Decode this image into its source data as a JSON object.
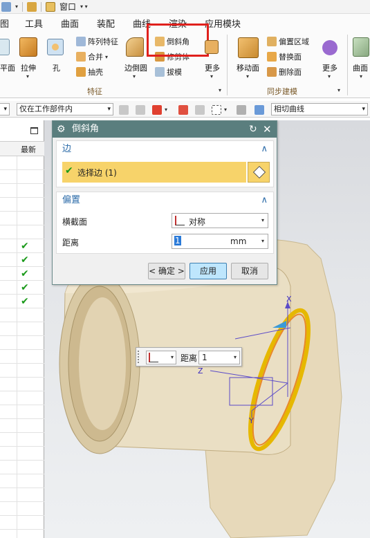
{
  "quick_access": {
    "window_menu": "窗口"
  },
  "menubar": {
    "items": [
      "图",
      "工具",
      "曲面",
      "装配",
      "曲线",
      "渲染",
      "应用模块"
    ]
  },
  "ribbon": {
    "buttons": {
      "plane": "平面",
      "extrude": "拉伸",
      "hole": "孔",
      "edge_blend": "边倒圆",
      "more1": "更多",
      "move_face": "移动面",
      "more2": "更多",
      "surface": "曲面"
    },
    "feature_small": [
      "阵列特征",
      "合并",
      "抽壳"
    ],
    "chamfer_small": [
      "倒斜角",
      "修剪体",
      "拔模"
    ],
    "sync_small": [
      "偏置区域",
      "替换面",
      "删除面"
    ],
    "groups": {
      "feature": "特征",
      "sync": "同步建模"
    }
  },
  "selection_bar": {
    "scope": "仅在工作部件内",
    "curve_rule": "相切曲线"
  },
  "left_panel": {
    "column_header": "最新",
    "check_rows": 5
  },
  "dialog": {
    "title": "倒斜角",
    "section_edge": {
      "title": "边",
      "select_label": "选择边 (1)"
    },
    "section_offset": {
      "title": "偏置",
      "cross_section_label": "横截面",
      "cross_section_value": "对称",
      "distance_label": "距离",
      "distance_value": "1",
      "unit": "mm"
    },
    "buttons": {
      "ok": "< 确定 >",
      "apply": "应用",
      "cancel": "取消"
    }
  },
  "handle": {
    "distance_label": "距离",
    "distance_value": "1"
  },
  "axes": {
    "x": "X",
    "y": "Y",
    "z": "Z"
  },
  "colors": {
    "dialog_title": "#5a7e7e",
    "selected_row": "#f7d36a",
    "highlight_box": "#e0201c",
    "part": "#e9dcbf",
    "check": "#1a9a1a"
  }
}
